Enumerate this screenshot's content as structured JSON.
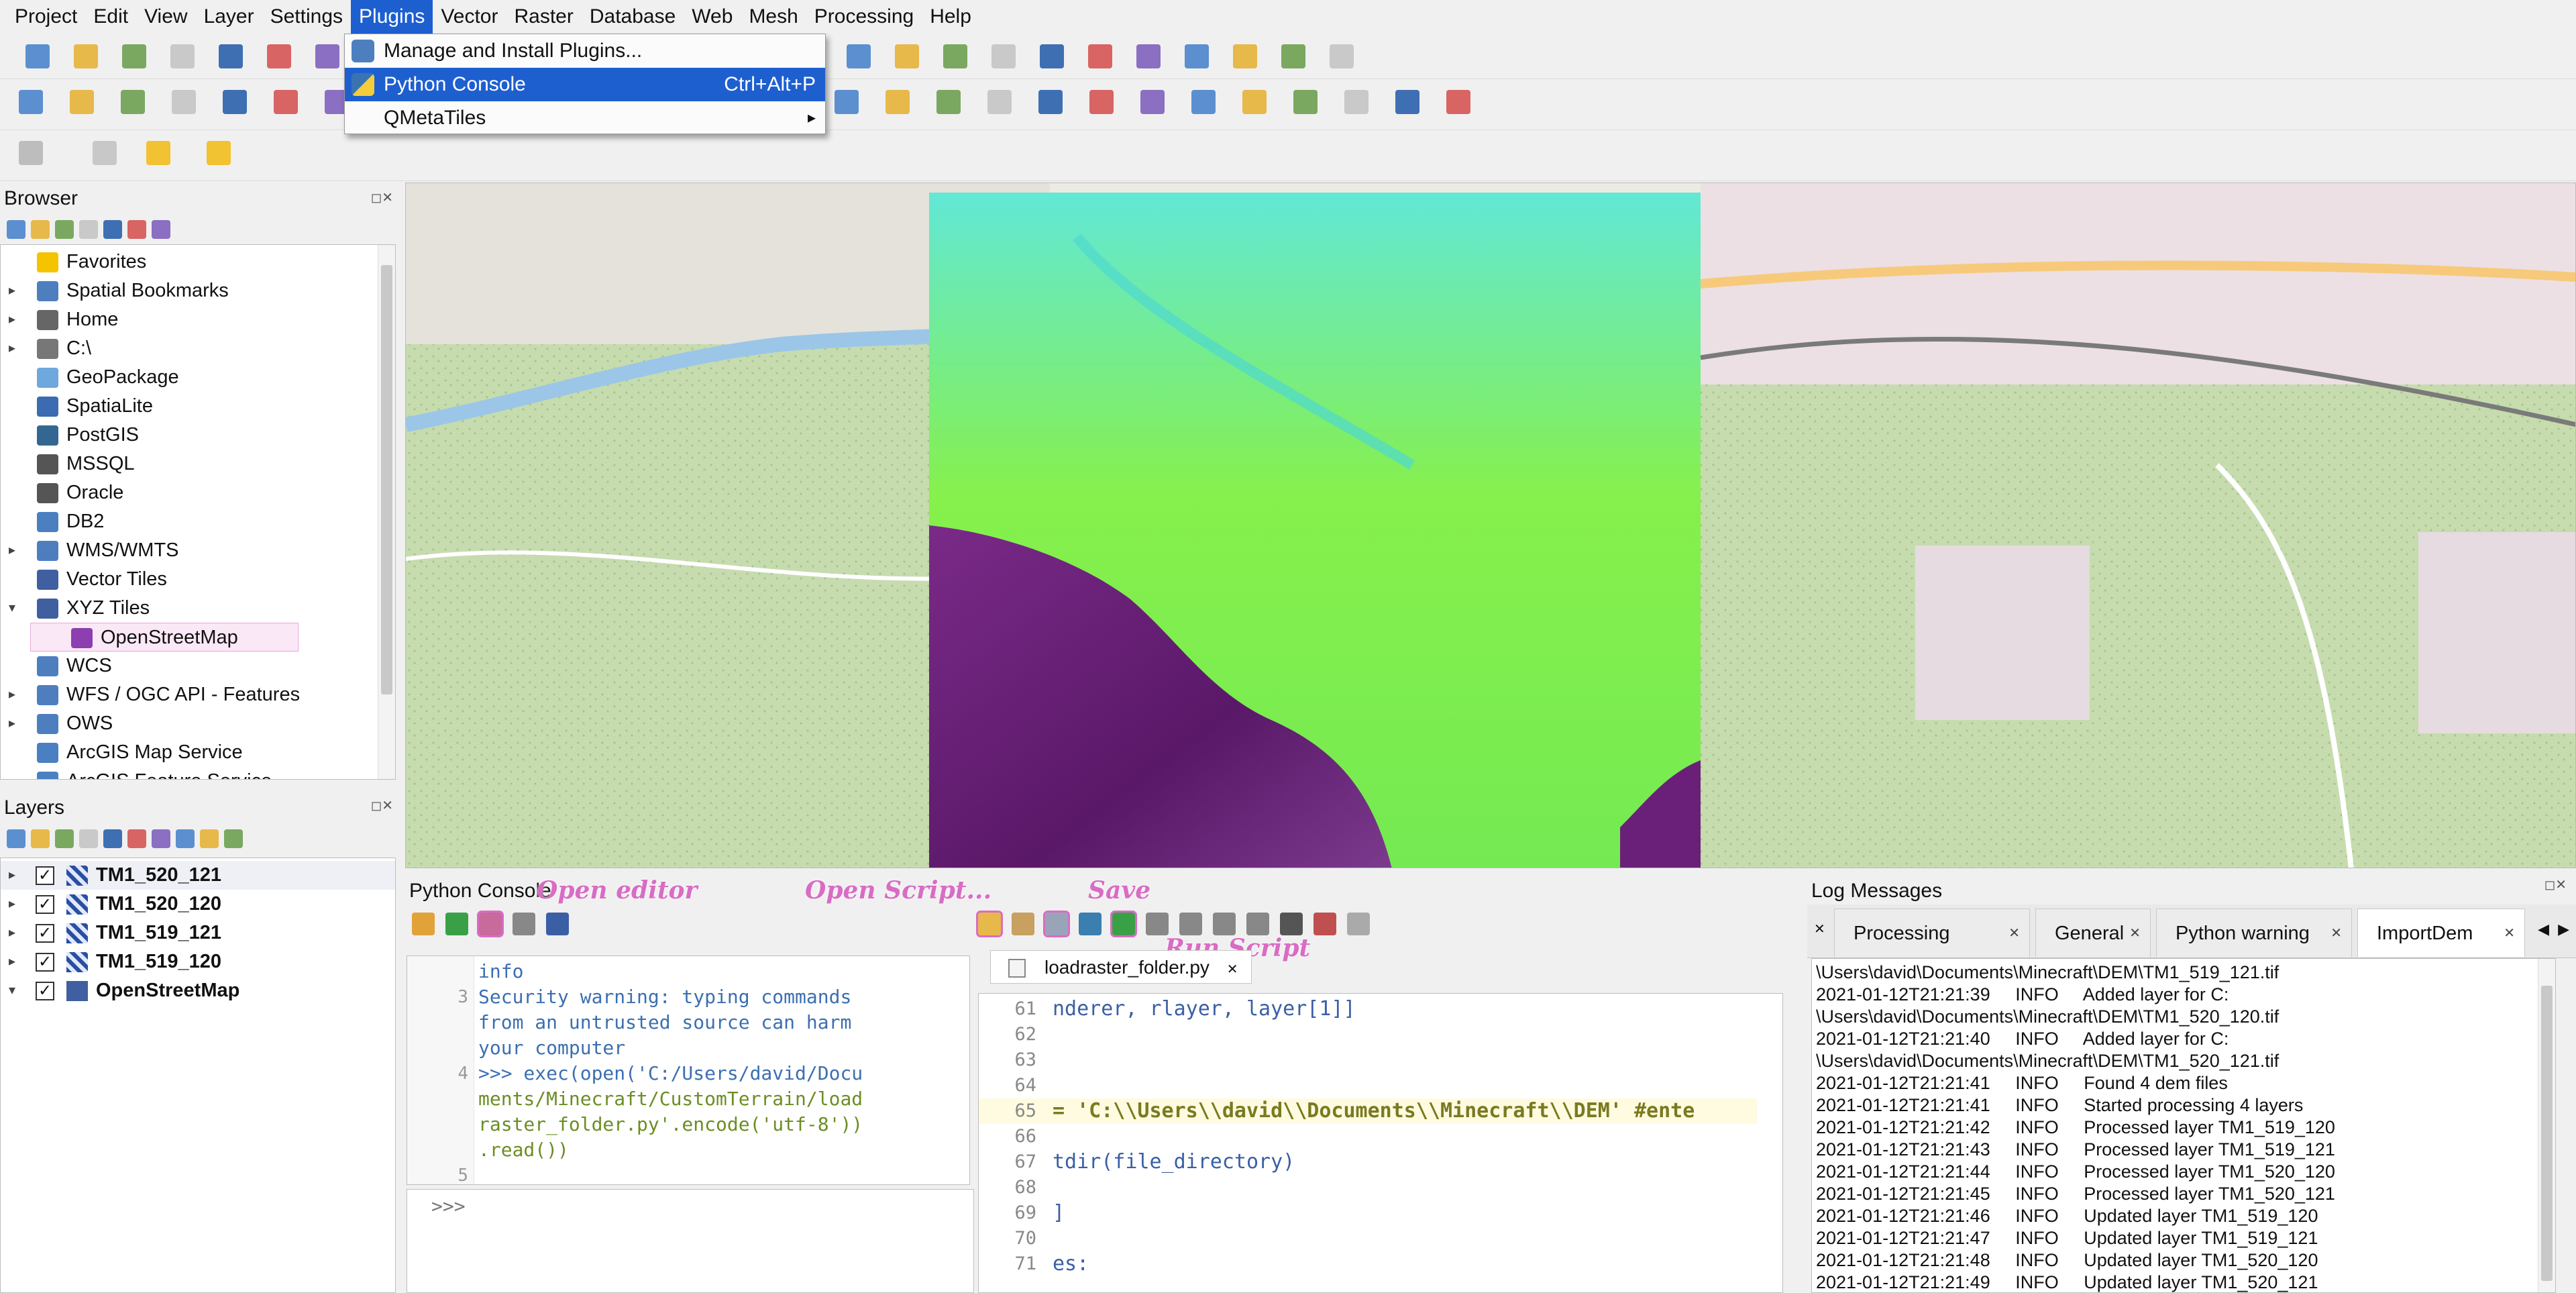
{
  "menubar": [
    "Project",
    "Edit",
    "View",
    "Layer",
    "Settings",
    "Plugins",
    "Vector",
    "Raster",
    "Database",
    "Web",
    "Mesh",
    "Processing",
    "Help"
  ],
  "plugins_menu": {
    "items": [
      {
        "label": "Manage and Install Plugins...",
        "shortcut": ""
      },
      {
        "label": "Python Console",
        "shortcut": "Ctrl+Alt+P"
      },
      {
        "label": "QMetaTiles",
        "shortcut": "",
        "submenu": "▸"
      }
    ]
  },
  "browser": {
    "title": "Browser",
    "items": [
      {
        "label": "Favorites",
        "icon": "star-icon",
        "color": "#f4c400",
        "arrow": ""
      },
      {
        "label": "Spatial Bookmarks",
        "icon": "bookmark-icon",
        "color": "#4d7fbf",
        "arrow": "▸"
      },
      {
        "label": "Home",
        "icon": "home-icon",
        "color": "#666666",
        "arrow": "▸"
      },
      {
        "label": "C:\\",
        "icon": "drive-icon",
        "color": "#777777",
        "arrow": "▸"
      },
      {
        "label": "GeoPackage",
        "icon": "geopackage-icon",
        "color": "#6fa8dc",
        "arrow": ""
      },
      {
        "label": "SpatiaLite",
        "icon": "feather-icon",
        "color": "#3b6bb0",
        "arrow": ""
      },
      {
        "label": "PostGIS",
        "icon": "elephant-icon",
        "color": "#336791",
        "arrow": ""
      },
      {
        "label": "MSSQL",
        "icon": "database-icon",
        "color": "#555555",
        "arrow": ""
      },
      {
        "label": "Oracle",
        "icon": "database-icon",
        "color": "#555555",
        "arrow": ""
      },
      {
        "label": "DB2",
        "icon": "db2-icon",
        "color": "#4a7fc0",
        "arrow": ""
      },
      {
        "label": "WMS/WMTS",
        "icon": "globe-icon",
        "color": "#4d7fbf",
        "arrow": "▸"
      },
      {
        "label": "Vector Tiles",
        "icon": "grid-icon",
        "color": "#3f5fa0",
        "arrow": ""
      },
      {
        "label": "XYZ Tiles",
        "icon": "grid-icon",
        "color": "#3f5fa0",
        "arrow": "▾"
      },
      {
        "label": "OpenStreetMap",
        "icon": "grid-icon",
        "color": "#8b3fb0",
        "arrow": "",
        "child": true
      },
      {
        "label": "WCS",
        "icon": "globe-icon",
        "color": "#4d7fbf",
        "arrow": ""
      },
      {
        "label": "WFS / OGC API - Features",
        "icon": "globe-icon",
        "color": "#4d7fbf",
        "arrow": "▸"
      },
      {
        "label": "OWS",
        "icon": "globe-icon",
        "color": "#4d7fbf",
        "arrow": "▸"
      },
      {
        "label": "ArcGIS Map Service",
        "icon": "arcgis-icon",
        "color": "#4a80c2",
        "arrow": ""
      },
      {
        "label": "ArcGIS Feature Service",
        "icon": "arcgis-icon",
        "color": "#4a80c2",
        "arrow": ""
      }
    ]
  },
  "layers": {
    "title": "Layers",
    "items": [
      {
        "label": "TM1_520_121"
      },
      {
        "label": "TM1_520_120"
      },
      {
        "label": "TM1_519_121"
      },
      {
        "label": "TM1_519_120"
      },
      {
        "label": "OpenStreetMap"
      }
    ]
  },
  "console": {
    "title": "Python Console",
    "annotations": {
      "open_editor": "Open editor",
      "open_script": "Open Script...",
      "save": "Save",
      "run_script": "Run Script"
    },
    "output_lines": [
      {
        "n": "",
        "t": "info"
      },
      {
        "n": "3",
        "t": "Security warning: typing commands"
      },
      {
        "n": "",
        "t": "from an untrusted source can harm"
      },
      {
        "n": "",
        "t": "your computer"
      },
      {
        "n": "4",
        "t": ">>> exec(open('C:/Users/david/Docu"
      },
      {
        "n": "",
        "t": "ments/Minecraft/CustomTerrain/load"
      },
      {
        "n": "",
        "t": "raster_folder.py'.encode('utf-8'))"
      },
      {
        "n": "",
        "t": ".read())"
      },
      {
        "n": "5",
        "t": ""
      }
    ],
    "prompt": ">>>",
    "editor_tab": "loadraster_folder.py",
    "editor_lines": [
      {
        "n": "61",
        "t": "nderer, rlayer, layer[1]]"
      },
      {
        "n": "62",
        "t": ""
      },
      {
        "n": "63",
        "t": ""
      },
      {
        "n": "64",
        "t": ""
      },
      {
        "n": "65",
        "t": "= 'C:\\\\Users\\\\david\\\\Documents\\\\Minecraft\\\\DEM' #ente"
      },
      {
        "n": "66",
        "t": ""
      },
      {
        "n": "67",
        "t": "tdir(file_directory)"
      },
      {
        "n": "68",
        "t": ""
      },
      {
        "n": "69",
        "t": "]"
      },
      {
        "n": "70",
        "t": ""
      },
      {
        "n": "71",
        "t": "es:"
      }
    ]
  },
  "log": {
    "title": "Log Messages",
    "tabs": [
      "Processing",
      "General",
      "Python warning",
      "ImportDem"
    ],
    "active_tab": "ImportDem",
    "lines": [
      "\\Users\\david\\Documents\\Minecraft\\DEM\\TM1_519_121.tif",
      "2021-01-12T21:21:39     INFO     Added layer for C:",
      "\\Users\\david\\Documents\\Minecraft\\DEM\\TM1_520_120.tif",
      "2021-01-12T21:21:40     INFO     Added layer for C:",
      "\\Users\\david\\Documents\\Minecraft\\DEM\\TM1_520_121.tif",
      "2021-01-12T21:21:41     INFO     Found 4 dem files",
      "2021-01-12T21:21:41     INFO     Started processing 4 layers",
      "2021-01-12T21:21:42     INFO     Processed layer TM1_519_120",
      "2021-01-12T21:21:43     INFO     Processed layer TM1_519_121",
      "2021-01-12T21:21:44     INFO     Processed layer TM1_520_120",
      "2021-01-12T21:21:45     INFO     Processed layer TM1_520_121",
      "2021-01-12T21:21:46     INFO     Updated layer TM1_519_120",
      "2021-01-12T21:21:47     INFO     Updated layer TM1_519_121",
      "2021-01-12T21:21:48     INFO     Updated layer TM1_520_120",
      "2021-01-12T21:21:49     INFO     Updated layer TM1_520_121"
    ]
  },
  "colors": {
    "accent": "#1e5fd0",
    "dem_green": "#7ef24a",
    "dem_cyan": "#5fe8d8",
    "dem_purple": "#6a1f7a",
    "annotation": "#d96cc4"
  }
}
